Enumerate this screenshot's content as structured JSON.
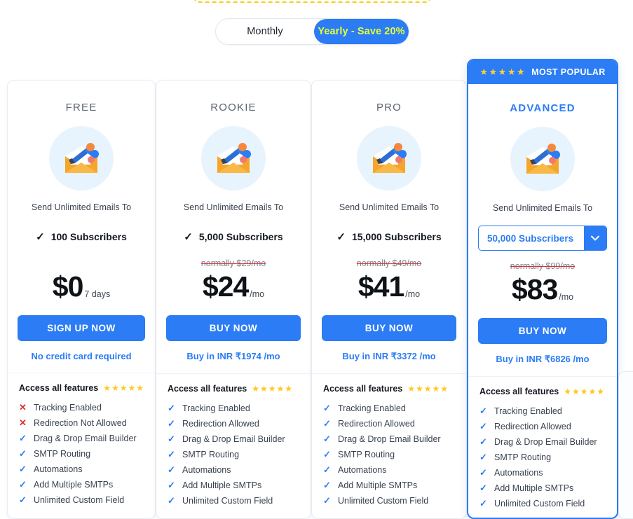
{
  "billing_toggle": {
    "monthly_label": "Monthly",
    "yearly_label": "Yearly - Save 20%",
    "selected": "Yearly - Save 20%"
  },
  "badge": {
    "stars": "★★★★★",
    "label": "MOST POPULAR"
  },
  "common": {
    "send_to_label": "Send Unlimited Emails To",
    "features_heading": "Access all features",
    "features_stars": "★★★★★",
    "tick_glyph": "✓",
    "cross_glyph": "✕",
    "caret_icon": "chevron-down-icon",
    "plan_icon": "email-megaphone-icon"
  },
  "colors": {
    "brand_blue": "#2b7cf5",
    "accent_yellow": "#e4ff36",
    "star_yellow": "#ffc91e",
    "strike_red": "#e03030",
    "icon_circle": "#e8f4fd"
  },
  "plans": [
    {
      "name": "FREE",
      "featured": false,
      "subscribers": "100 Subscribers",
      "has_select": false,
      "was_price": "",
      "price": "$0",
      "price_suffix": "7 days",
      "cta_label": "SIGN UP NOW",
      "subnote": "No credit card required",
      "features": [
        {
          "label": "Tracking Enabled",
          "included": false
        },
        {
          "label": "Redirection Not Allowed",
          "included": false
        },
        {
          "label": "Drag & Drop Email Builder",
          "included": true
        },
        {
          "label": "SMTP Routing",
          "included": true
        },
        {
          "label": "Automations",
          "included": true
        },
        {
          "label": "Add Multiple SMTPs",
          "included": true
        },
        {
          "label": "Unlimited Custom Field",
          "included": true
        }
      ]
    },
    {
      "name": "ROOKIE",
      "featured": false,
      "subscribers": "5,000 Subscribers",
      "has_select": false,
      "was_price": "normally $29/mo",
      "price": "$24",
      "price_suffix": "/mo",
      "cta_label": "BUY NOW",
      "subnote": "Buy in INR ₹1974 /mo",
      "features": [
        {
          "label": "Tracking Enabled",
          "included": true
        },
        {
          "label": "Redirection Allowed",
          "included": true
        },
        {
          "label": "Drag & Drop Email Builder",
          "included": true
        },
        {
          "label": "SMTP Routing",
          "included": true
        },
        {
          "label": "Automations",
          "included": true
        },
        {
          "label": "Add Multiple SMTPs",
          "included": true
        },
        {
          "label": "Unlimited Custom Field",
          "included": true
        }
      ]
    },
    {
      "name": "PRO",
      "featured": false,
      "subscribers": "15,000 Subscribers",
      "has_select": false,
      "was_price": "normally $49/mo",
      "price": "$41",
      "price_suffix": "/mo",
      "cta_label": "BUY NOW",
      "subnote": "Buy in INR ₹3372 /mo",
      "features": [
        {
          "label": "Tracking Enabled",
          "included": true
        },
        {
          "label": "Redirection Allowed",
          "included": true
        },
        {
          "label": "Drag & Drop Email Builder",
          "included": true
        },
        {
          "label": "SMTP Routing",
          "included": true
        },
        {
          "label": "Automations",
          "included": true
        },
        {
          "label": "Add Multiple SMTPs",
          "included": true
        },
        {
          "label": "Unlimited Custom Field",
          "included": true
        }
      ]
    },
    {
      "name": "ADVANCED",
      "featured": true,
      "subscribers": "50,000 Subscribers",
      "has_select": true,
      "select_value": "50,000 Subscribers",
      "was_price": "normally $99/mo",
      "price": "$83",
      "price_suffix": "/mo",
      "cta_label": "BUY NOW",
      "subnote": "Buy in INR ₹6826 /mo",
      "features": [
        {
          "label": "Tracking Enabled",
          "included": true
        },
        {
          "label": "Redirection Allowed",
          "included": true
        },
        {
          "label": "Drag & Drop Email Builder",
          "included": true
        },
        {
          "label": "SMTP Routing",
          "included": true
        },
        {
          "label": "Automations",
          "included": true
        },
        {
          "label": "Add Multiple SMTPs",
          "included": true
        },
        {
          "label": "Unlimited Custom Field",
          "included": true
        }
      ]
    }
  ]
}
